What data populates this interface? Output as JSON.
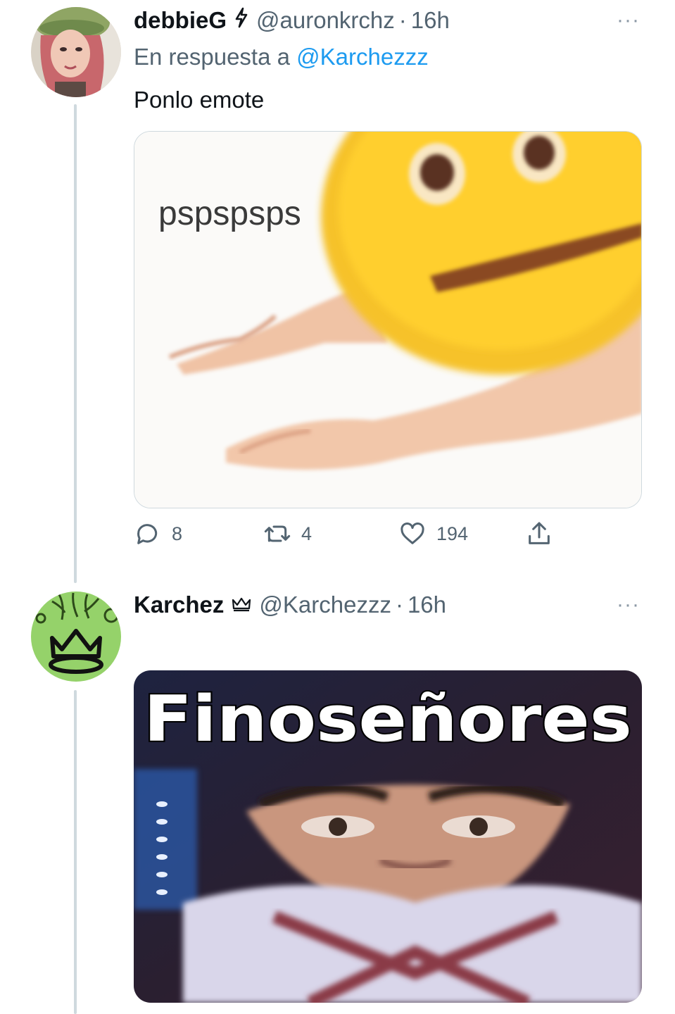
{
  "tweet1": {
    "display_name": "debbieG",
    "badge_icon": "lightning-icon",
    "handle": "@auronkrchz",
    "separator": "·",
    "time": "16h",
    "more_label": "···",
    "reply_prefix": "En respuesta a",
    "reply_mention": "@Karchezzz",
    "text": "Ponlo emote",
    "media_caption": "pspspsps",
    "actions": {
      "replies": "8",
      "retweets": "4",
      "likes": "194"
    }
  },
  "tweet2": {
    "display_name": "Karchez",
    "badge_icon": "crown-icon",
    "handle": "@Karchezzz",
    "separator": "·",
    "time": "16h",
    "more_label": "···",
    "media_caption": "Finoseñores"
  },
  "colors": {
    "link": "#1d9bf0",
    "secondary_text": "#536471",
    "thread_line": "#cfd9de",
    "emoji_yellow": "#f5c518",
    "avatar_green": "#9bd36a"
  }
}
